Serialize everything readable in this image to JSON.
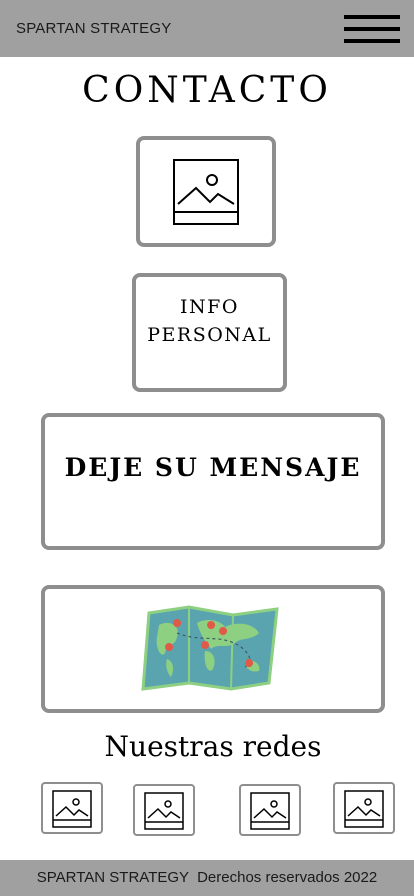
{
  "header": {
    "brand": "SPARTAN STRATEGY",
    "menu_icon": "hamburger-menu-icon"
  },
  "page": {
    "title": "CONTACTO"
  },
  "sections": {
    "photo_icon": "image-placeholder-icon",
    "info_label": "INFO\nPERSONAL",
    "message_label": "DEJE SU MENSAJE",
    "map_icon": "world-map-icon"
  },
  "social": {
    "title": "Nuestras redes",
    "icons": [
      "image-placeholder-icon",
      "image-placeholder-icon",
      "image-placeholder-icon",
      "image-placeholder-icon"
    ]
  },
  "footer": {
    "text": "SPARTAN STRATEGY  Derechos reservados 2022"
  },
  "colors": {
    "bar_gray": "#a0a0a0",
    "border_gray": "#8e8e8e",
    "map_water": "#5aa4b0",
    "map_land": "#8ed081",
    "pin_red": "#e05a4a"
  }
}
